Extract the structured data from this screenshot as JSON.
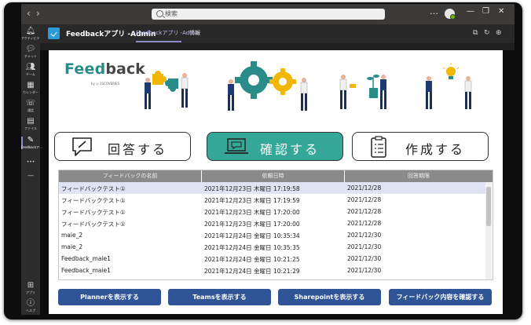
{
  "titlebar": {
    "search_placeholder": "検索",
    "more": "…"
  },
  "rail": {
    "items": [
      {
        "label": "アクティビティ",
        "icon": "bell-icon"
      },
      {
        "label": "チャット",
        "icon": "chat-icon"
      },
      {
        "label": "チーム",
        "icon": "teams-icon"
      },
      {
        "label": "カレンダー",
        "icon": "calendar-icon"
      },
      {
        "label": "通話",
        "icon": "phone-icon"
      },
      {
        "label": "ファイル",
        "icon": "file-icon"
      },
      {
        "label": "Feedbackア...",
        "icon": "pen-icon"
      },
      {
        "label": "アプリ",
        "icon": "apps-icon"
      },
      {
        "label": "ヘルプ",
        "icon": "help-icon"
      }
    ],
    "more": "•••"
  },
  "apphead": {
    "name": "Feedbackアプリ -Admin",
    "tab_active": "Feedbackアプリ -Admin",
    "tab_info": "情報"
  },
  "logo": {
    "part1": "Feed",
    "part2": "back",
    "byline": "by ◎ 2SCOVERIES"
  },
  "actions": {
    "answer": "回答する",
    "confirm": "確認する",
    "create": "作成する"
  },
  "table": {
    "headers": [
      "フィードバックの名前",
      "依頼日時",
      "回答期限"
    ],
    "rows": [
      [
        "フィードバックテスト①",
        "2021年12月23日 木曜日 17:19:58",
        "2021/12/28"
      ],
      [
        "フィードバックテスト①",
        "2021年12月23日 木曜日 17:19:59",
        "2021/12/28"
      ],
      [
        "フィードバックテスト①",
        "2021年12月23日 木曜日 17:20:00",
        "2021/12/28"
      ],
      [
        "フィードバックテスト①",
        "2021年12月23日 木曜日 17:20:00",
        "2021/12/28"
      ],
      [
        "maie_2",
        "2021年12月24日 金曜日 10:35:34",
        "2021/12/30"
      ],
      [
        "maie_2",
        "2021年12月24日 金曜日 10:35:35",
        "2021/12/30"
      ],
      [
        "Feedback_maie1",
        "2021年12月24日 金曜日 10:21:25",
        "2021/12/30"
      ],
      [
        "Feedback_maie1",
        "2021年12月24日 金曜日 10:21:29",
        "2021/12/30"
      ]
    ]
  },
  "bottom": {
    "planner": "Plannerを表示する",
    "teams": "Teamsを表示する",
    "sharepoint": "Sharepointを表示する",
    "feedback": "フィードバック内容を確認する"
  },
  "colors": {
    "teal": "#34a799",
    "button_blue": "#2f5597",
    "header_gray": "#8a8a8a",
    "selected_row": "#dfe3f3",
    "teams_accent": "#8b8cc7"
  }
}
